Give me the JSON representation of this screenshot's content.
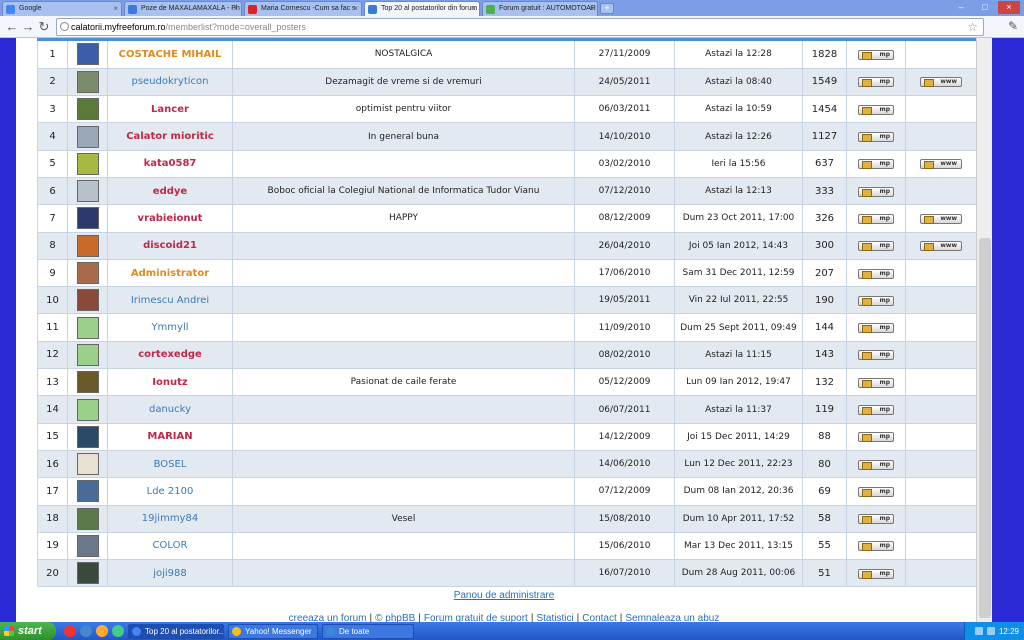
{
  "tabs": [
    {
      "label": "Google",
      "icon": "google-icon",
      "color": "#4285f4"
    },
    {
      "label": "Poze de MAXALAMAXALA - Ph",
      "icon": "photobucket-icon",
      "color": "#3b7ad8"
    },
    {
      "label": "Maria Cornescu -Cum sa fac s",
      "icon": "youtube-icon",
      "color": "#d22"
    },
    {
      "label": "Top 20 al postatorilor din forum",
      "icon": "forum-icon",
      "color": "#3b7ad8",
      "active": true
    },
    {
      "label": "Forum gratuit : AUTOMOTOAR",
      "icon": "forum-icon",
      "color": "#4caf50"
    }
  ],
  "address": {
    "host": "calatorii.myfreeforum.ro",
    "path": "/memberlist?mode=overall_posters"
  },
  "rows": [
    {
      "rank": "1",
      "user": "COSTACHE MIHAIL",
      "color": "#e08a1a",
      "bold": true,
      "signature": "NOSTALGICA",
      "joined": "27/11/2009",
      "last": "Astazi la 12:28",
      "posts": "1828",
      "www": false,
      "avatar": "#3a5ea8"
    },
    {
      "rank": "2",
      "user": "pseudokryticon",
      "color": "#3a7ab8",
      "bold": false,
      "signature": "Dezamagit de vreme si de vremuri",
      "joined": "24/05/2011",
      "last": "Astazi la 08:40",
      "posts": "1549",
      "www": true,
      "avatar": "#7a8a6a"
    },
    {
      "rank": "3",
      "user": "Lancer",
      "color": "#c0284a",
      "bold": true,
      "signature": "optimist pentru viitor",
      "joined": "06/03/2011",
      "last": "Astazi la 10:59",
      "posts": "1454",
      "www": false,
      "avatar": "#5a7a3a"
    },
    {
      "rank": "4",
      "user": "Calator mioritic",
      "color": "#c0284a",
      "bold": true,
      "signature": "In general buna",
      "joined": "14/10/2010",
      "last": "Astazi la 12:26",
      "posts": "1127",
      "www": false,
      "avatar": "#9aa8b8"
    },
    {
      "rank": "5",
      "user": "kata0587",
      "color": "#c0284a",
      "bold": true,
      "signature": "",
      "joined": "03/02/2010",
      "last": "Ieri la 15:56",
      "posts": "637",
      "www": true,
      "avatar": "#a8b840"
    },
    {
      "rank": "6",
      "user": "eddye",
      "color": "#c0284a",
      "bold": true,
      "signature": "Boboc oficial la Colegiul National de Informatica Tudor Vianu",
      "joined": "07/12/2010",
      "last": "Astazi la 12:13",
      "posts": "333",
      "www": false,
      "avatar": "#b8c0c8"
    },
    {
      "rank": "7",
      "user": "vrabieionut",
      "color": "#c0284a",
      "bold": true,
      "signature": "HAPPY",
      "joined": "08/12/2009",
      "last": "Dum 23 Oct 2011, 17:00",
      "posts": "326",
      "www": true,
      "avatar": "#2a3a6a"
    },
    {
      "rank": "8",
      "user": "discoid21",
      "color": "#c0284a",
      "bold": true,
      "signature": "",
      "joined": "26/04/2010",
      "last": "Joi 05 Ian 2012, 14:43",
      "posts": "300",
      "www": true,
      "avatar": "#c86a2a"
    },
    {
      "rank": "9",
      "user": "Administrator",
      "color": "#e08a1a",
      "bold": true,
      "signature": "",
      "joined": "17/06/2010",
      "last": "Sam 31 Dec 2011, 12:59",
      "posts": "207",
      "www": false,
      "avatar": "#a86a4a"
    },
    {
      "rank": "10",
      "user": "Irimescu Andrei",
      "color": "#3a7ab8",
      "bold": false,
      "signature": "",
      "joined": "19/05/2011",
      "last": "Vin 22 Iul 2011, 22:55",
      "posts": "190",
      "www": false,
      "avatar": "#8a4a3a"
    },
    {
      "rank": "11",
      "user": "Ymmyll",
      "color": "#3a7ab8",
      "bold": false,
      "signature": "",
      "joined": "11/09/2010",
      "last": "Dum 25 Sept 2011, 09:49",
      "posts": "144",
      "www": false,
      "avatar": "#9ad08a"
    },
    {
      "rank": "12",
      "user": "cortexedge",
      "color": "#c0284a",
      "bold": true,
      "signature": "",
      "joined": "08/02/2010",
      "last": "Astazi la 11:15",
      "posts": "143",
      "www": false,
      "avatar": "#9ad08a"
    },
    {
      "rank": "13",
      "user": "Ionutz",
      "color": "#c0284a",
      "bold": true,
      "signature": "Pasionat de caile ferate",
      "joined": "05/12/2009",
      "last": "Lun 09 Ian 2012, 19:47",
      "posts": "132",
      "www": false,
      "avatar": "#6a5a2a"
    },
    {
      "rank": "14",
      "user": "danucky",
      "color": "#3a7ab8",
      "bold": false,
      "signature": "",
      "joined": "06/07/2011",
      "last": "Astazi la 11:37",
      "posts": "119",
      "www": false,
      "avatar": "#9ad08a"
    },
    {
      "rank": "15",
      "user": "MARIAN",
      "color": "#c0284a",
      "bold": true,
      "signature": "",
      "joined": "14/12/2009",
      "last": "Joi 15 Dec 2011, 14:29",
      "posts": "88",
      "www": false,
      "avatar": "#2a4a6a"
    },
    {
      "rank": "16",
      "user": "BOSEL",
      "color": "#3a7ab8",
      "bold": false,
      "signature": "",
      "joined": "14/06/2010",
      "last": "Lun 12 Dec 2011, 22:23",
      "posts": "80",
      "www": false,
      "avatar": "#e8e0d0"
    },
    {
      "rank": "17",
      "user": "Lde 2100",
      "color": "#3a7ab8",
      "bold": false,
      "signature": "",
      "joined": "07/12/2009",
      "last": "Dum 08 Ian 2012, 20:36",
      "posts": "69",
      "www": false,
      "avatar": "#4a6a9a"
    },
    {
      "rank": "18",
      "user": "19jimmy84",
      "color": "#3a7ab8",
      "bold": false,
      "signature": "Vesel",
      "joined": "15/08/2010",
      "last": "Dum 10 Apr 2011, 17:52",
      "posts": "58",
      "www": false,
      "avatar": "#5a7a4a"
    },
    {
      "rank": "19",
      "user": "COLOR",
      "color": "#3a7ab8",
      "bold": false,
      "signature": "",
      "joined": "15/06/2010",
      "last": "Mar 13 Dec 2011, 13:15",
      "posts": "55",
      "www": false,
      "avatar": "#6a7a8a"
    },
    {
      "rank": "20",
      "user": "joji988",
      "color": "#3a7ab8",
      "bold": false,
      "signature": "",
      "joined": "16/07/2010",
      "last": "Dum 28 Aug 2011, 00:06",
      "posts": "51",
      "www": false,
      "avatar": "#3a4a3a"
    }
  ],
  "buttons": {
    "mp": "mp",
    "www": "www"
  },
  "footer": {
    "admin": "Panou de administrare",
    "links": [
      "creeaza un forum",
      "© phpBB",
      "Forum gratuit de suport",
      "Statistici",
      "Contact",
      "Semnaleaza un abuz"
    ]
  },
  "taskbar": {
    "start": "start",
    "tasks": [
      {
        "label": "Top 20 al postatorilor...",
        "color": "#4285f4",
        "active": true
      },
      {
        "label": "Yahoo! Messenger",
        "color": "#f0c020",
        "active": false
      },
      {
        "label": "De toate",
        "color": "#3a8ad8",
        "active": false
      }
    ],
    "clock": "12:29"
  }
}
